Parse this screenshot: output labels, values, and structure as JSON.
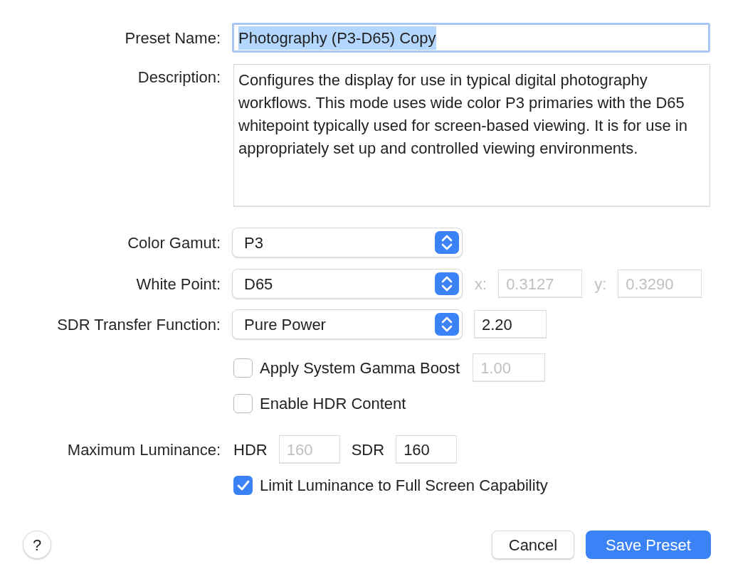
{
  "preset_name": {
    "label": "Preset Name:",
    "value": "Photography (P3-D65) Copy",
    "text_selected": true
  },
  "description": {
    "label": "Description:",
    "value": "Configures the display for use in typical digital photography workflows. This mode uses wide color P3 primaries with the D65 whitepoint typically used for screen-based viewing. It is for use in appropriately set up and controlled viewing environments."
  },
  "color_gamut": {
    "label": "Color Gamut:",
    "value": "P3"
  },
  "white_point": {
    "label": "White Point:",
    "value": "D65",
    "x_label": "x:",
    "x_value": "0.3127",
    "y_label": "y:",
    "y_value": "0.3290",
    "disabled": true
  },
  "sdr_transfer": {
    "label": "SDR Transfer Function:",
    "value": "Pure Power",
    "gamma": "2.20"
  },
  "gamma_boost": {
    "label": "Apply System Gamma Boost",
    "checked": false,
    "value": "1.00",
    "disabled": true
  },
  "enable_hdr": {
    "label": "Enable HDR Content",
    "checked": false
  },
  "max_luminance": {
    "label": "Maximum Luminance:",
    "hdr_label": "HDR",
    "hdr_value": "160",
    "hdr_disabled": true,
    "sdr_label": "SDR",
    "sdr_value": "160"
  },
  "limit_luminance": {
    "label": "Limit Luminance to Full Screen Capability",
    "checked": true
  },
  "help": {
    "label": "?"
  },
  "buttons": [
    {
      "label": "Cancel",
      "kind": "secondary"
    },
    {
      "label": "Save Preset",
      "kind": "primary"
    }
  ]
}
